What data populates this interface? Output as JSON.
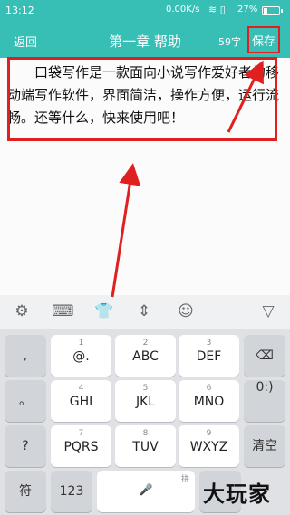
{
  "status_bar": {
    "time": "13:12",
    "net_speed": "0.00K/s",
    "signal_glyph": "≋ ▯",
    "battery_percent": "27%",
    "battery_level": 0.27
  },
  "nav": {
    "back_label": "返回",
    "title": "第一章 帮助",
    "word_count": "59字",
    "save_label": "保存"
  },
  "editor": {
    "content": "口袋写作是一款面向小说写作爱好者的移动端写作软件，界面简洁，操作方便，运行流畅。还等什么，快来使用吧！"
  },
  "keyboard": {
    "toolbar_icons": [
      "gear-icon",
      "keyboard-icon",
      "shirt-icon",
      "cursor-move-icon",
      "emoji-icon",
      "collapse-icon"
    ],
    "toolbar_glyphs": [
      "⚙",
      "⌨",
      "👕",
      "⇕",
      "☺",
      "▽"
    ],
    "left_column": [
      ",",
      "。",
      "?",
      "!"
    ],
    "keys": [
      {
        "num": "1",
        "label": "@."
      },
      {
        "num": "2",
        "label": "ABC"
      },
      {
        "num": "3",
        "label": "DEF"
      },
      {
        "num": "4",
        "label": "GHI"
      },
      {
        "num": "5",
        "label": "JKL"
      },
      {
        "num": "6",
        "label": "MNO"
      },
      {
        "num": "7",
        "label": "PQRS"
      },
      {
        "num": "8",
        "label": "TUV"
      },
      {
        "num": "9",
        "label": "WXYZ"
      }
    ],
    "right_column": {
      "backspace": "⌫",
      "zero_num": "0",
      "zero_label": ":)",
      "clear": "清空"
    },
    "bottom_row": {
      "symbol": "符",
      "num": "123",
      "space_hint": "拼",
      "mic": "🎤"
    }
  },
  "watermark": "大玩家"
}
